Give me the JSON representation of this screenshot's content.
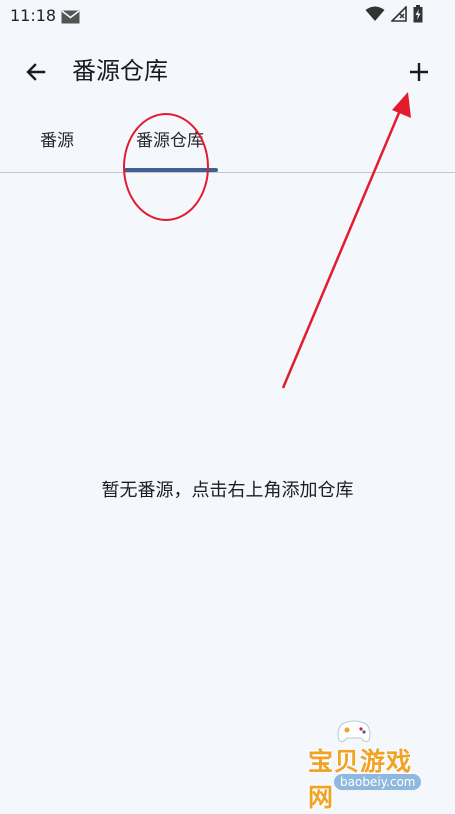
{
  "status_bar": {
    "time": "11:18",
    "icons": [
      "mail-icon",
      "wifi-icon",
      "no-signal-icon",
      "battery-charging-icon"
    ]
  },
  "app_bar": {
    "title": "番源仓库",
    "back_icon": "arrow-left-icon",
    "add_icon": "plus-icon"
  },
  "tabs": [
    {
      "label": "番源",
      "selected": false
    },
    {
      "label": "番源仓库",
      "selected": true
    }
  ],
  "empty_state": {
    "message": "暂无番源，点击右上角添加仓库"
  },
  "annotations": {
    "circle_color": "#e21b2d",
    "arrow_color": "#e21b2d"
  },
  "watermark": {
    "name": "宝贝游戏网",
    "url": "baobeiy.com"
  },
  "colors": {
    "background": "#f4f8fd",
    "tab_indicator": "#3f6191"
  }
}
